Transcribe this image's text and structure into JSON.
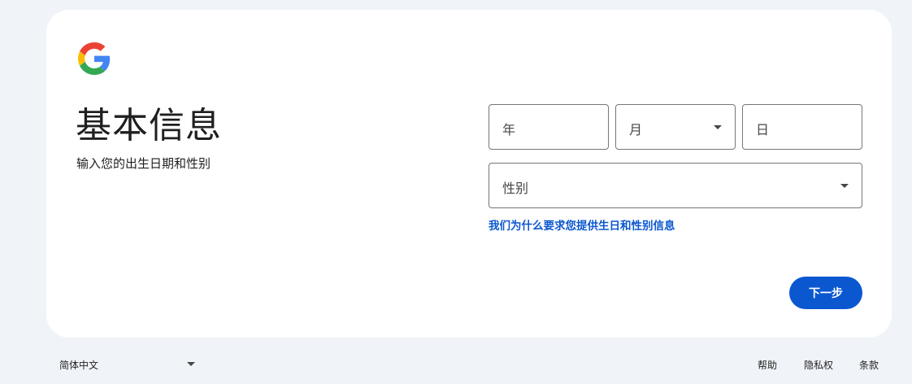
{
  "header": {
    "title": "基本信息",
    "subtitle": "输入您的出生日期和性别"
  },
  "form": {
    "year_label": "年",
    "month_label": "月",
    "day_label": "日",
    "gender_label": "性别",
    "why_link": "我们为什么要求您提供生日和性别信息",
    "next_label": "下一步"
  },
  "footer": {
    "language": "简体中文",
    "help": "帮助",
    "privacy": "隐私权",
    "terms": "条款"
  },
  "colors": {
    "accent": "#0b57d0",
    "page_bg": "#f0f4f9",
    "card_bg": "#ffffff"
  },
  "icons": {
    "logo": "google-g-logo",
    "dropdown": "caret-down-icon"
  }
}
